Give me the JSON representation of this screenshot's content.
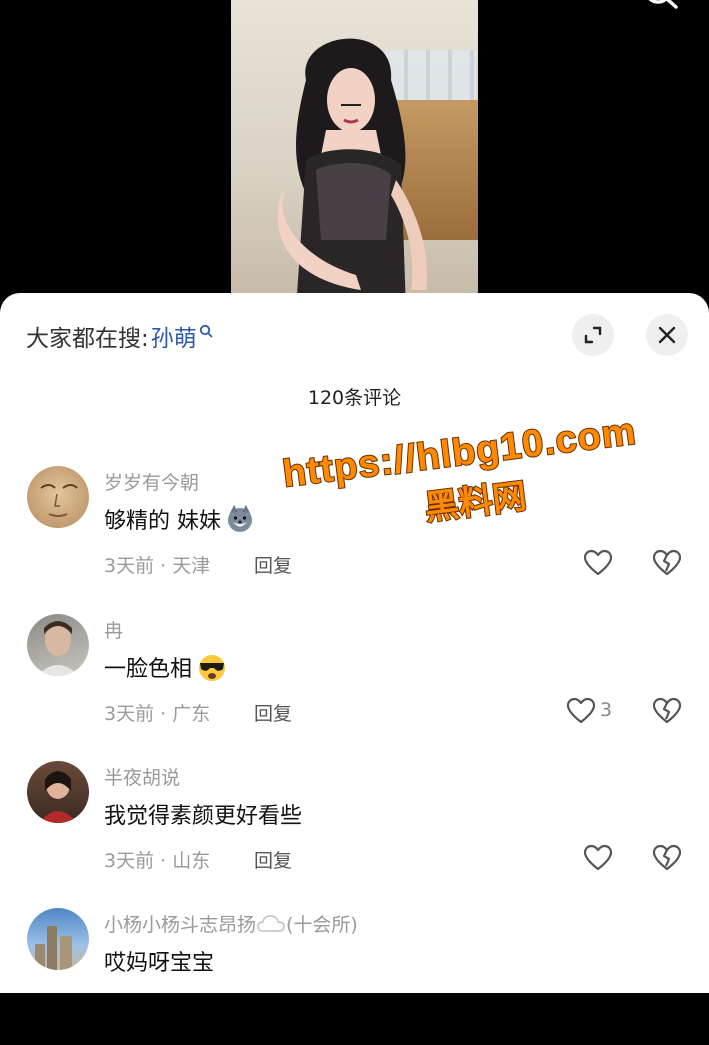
{
  "trending": {
    "prefix": "大家都在搜:",
    "keyword": "孙萌"
  },
  "comments_header": {
    "count_label": "120条评论"
  },
  "watermark": {
    "line1": "https://hlbg10.com",
    "line2": "黑料网"
  },
  "comments": [
    {
      "username": "岁岁有今朝",
      "text": "够精的  妹妹",
      "emoji": "wolf-emoji",
      "time": "3天前",
      "location": "天津",
      "reply": "回复",
      "likes": ""
    },
    {
      "username": "冉",
      "text": "一脸色相",
      "emoji": "sunglasses-emoji",
      "time": "3天前",
      "location": "广东",
      "reply": "回复",
      "likes": "3"
    },
    {
      "username": "半夜胡说",
      "text": "我觉得素颜更好看些",
      "emoji": "",
      "time": "3天前",
      "location": "山东",
      "reply": "回复",
      "likes": ""
    },
    {
      "username": "小杨小杨斗志昂扬",
      "username_suffix": "(十会所)",
      "text": "哎妈呀宝宝",
      "emoji": "",
      "time": "",
      "location": "",
      "reply": "",
      "likes": ""
    }
  ],
  "meta_sep": " · ",
  "colors": {
    "keyword": "#2d5aa8",
    "watermark": "#ff8a00",
    "sheet_bg": "#ffffff"
  }
}
